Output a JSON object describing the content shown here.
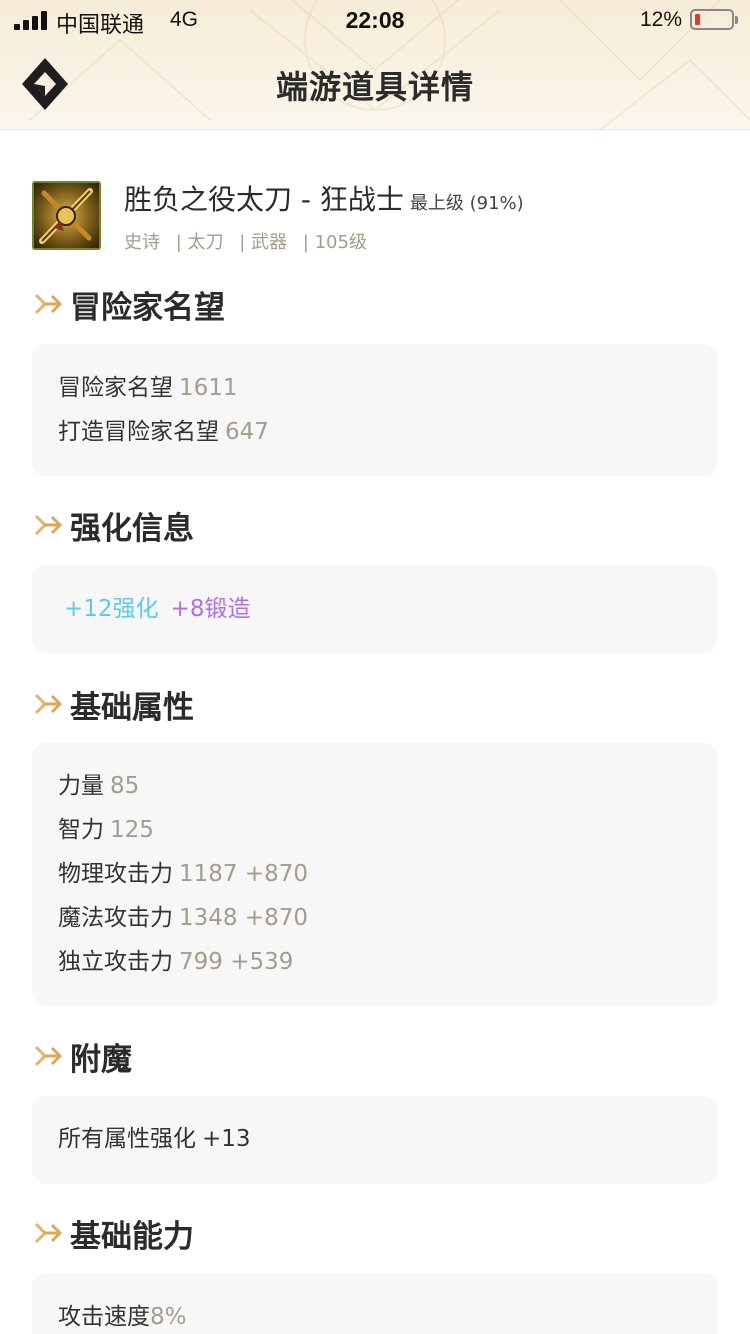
{
  "status_bar": {
    "carrier": "中国联通",
    "network": "4G",
    "time": "22:08",
    "battery_percent": "12%",
    "battery_level": 0.12
  },
  "nav": {
    "title": "端游道具详情",
    "logo_icon": "diamond-logo-icon"
  },
  "item": {
    "name": "胜负之役太刀 - 狂战士",
    "grade": "最上级 (91%)",
    "meta": [
      "史诗",
      "| 太刀",
      "| 武器",
      "| 105级"
    ],
    "icon": "katana-item-icon"
  },
  "sections": {
    "reputation": {
      "title": "冒险家名望",
      "rows": [
        {
          "label": "冒险家名望",
          "value": "1611"
        },
        {
          "label": "打造冒险家名望",
          "value": "647"
        }
      ]
    },
    "enhance": {
      "title": "强化信息",
      "reinforce": "+12强化",
      "forge": "+8锻造",
      "colors": {
        "reinforce": "#5ccbe8",
        "forge": "#b26ee8"
      }
    },
    "base_stats": {
      "title": "基础属性",
      "rows": [
        {
          "label": "力量",
          "value": "85"
        },
        {
          "label": "智力",
          "value": "125"
        },
        {
          "label": "物理攻击力",
          "value": "1187 +870"
        },
        {
          "label": "魔法攻击力",
          "value": "1348 +870"
        },
        {
          "label": "独立攻击力",
          "value": "799 +539"
        }
      ]
    },
    "enchant": {
      "title": "附魔",
      "rows": [
        {
          "label": "所有属性强化",
          "value": "+13"
        }
      ]
    },
    "abilities": {
      "title": "基础能力",
      "rows": [
        {
          "label": "攻击速度",
          "value": "8%"
        }
      ]
    }
  },
  "colors": {
    "accent_gold": "#d9a85a",
    "muted_value": "#a49c8c",
    "card_bg": "#f7f7f7"
  }
}
